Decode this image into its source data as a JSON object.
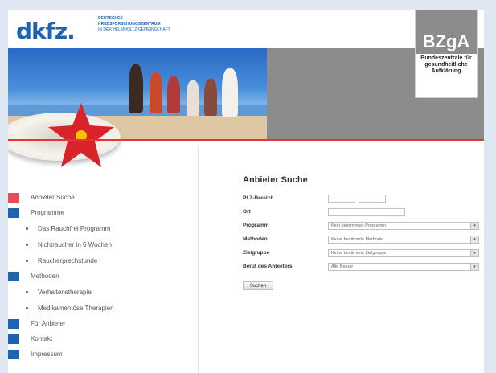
{
  "header": {
    "logo_text": "dkfz.",
    "subtitle_line1": "DEUTSCHES",
    "subtitle_line2": "KREBSFORSCHUNGSZENTRUM",
    "subtitle_line3": "IN DER HELMHOLTZ-GEMEINSCHAFT",
    "bzga_logo": "BZgA",
    "bzga_text": "Bundeszentrale für gesundheitliche Aufklärung"
  },
  "sidebar": {
    "items": [
      {
        "label": "Anbieter Suche",
        "color": "#e94b57",
        "level": 0
      },
      {
        "label": "Programme",
        "color": "#1d63b1",
        "level": 0
      },
      {
        "label": "Das Rauchfrei Programm",
        "level": 1
      },
      {
        "label": "Nichtraucher in 6 Wochen",
        "level": 1
      },
      {
        "label": "Raucherprechstunde",
        "level": 1
      },
      {
        "label": "Methoden",
        "color": "#1d63b1",
        "level": 0
      },
      {
        "label": "Verhaltenstherapie",
        "level": 1
      },
      {
        "label": "Medikamentöse Therapien",
        "level": 1
      },
      {
        "label": "Für Anbieter",
        "color": "#1d63b1",
        "level": 0
      },
      {
        "label": "Kontakt",
        "color": "#1d63b1",
        "level": 0
      },
      {
        "label": "Impressum",
        "color": "#1d63b1",
        "level": 0
      }
    ]
  },
  "form": {
    "title": "Anbieter Suche",
    "plz_label": "PLZ-Bereich",
    "ort_label": "Ort",
    "programm_label": "Programm",
    "programm_value": "Kein bestimmtes Programm",
    "methoden_label": "Methoden",
    "methoden_value": "Keine bestimmte Methode",
    "zielgruppe_label": "Zielgruppe",
    "zielgruppe_value": "Keine bestimmte Zielgruppe",
    "beruf_label": "Beruf des Anbieters",
    "beruf_value": "Alle Berufe",
    "submit_label": "Suchen"
  },
  "colors": {
    "accent_red": "#e1353d",
    "brand_blue": "#1d63b1"
  }
}
